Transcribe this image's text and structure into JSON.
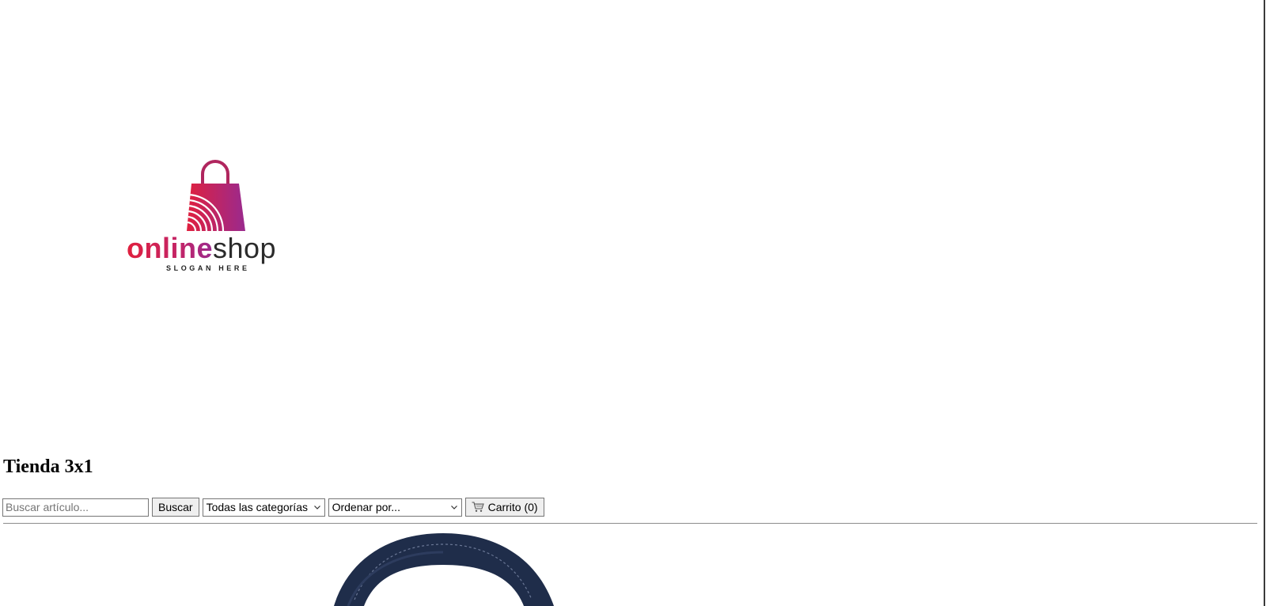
{
  "logo": {
    "word_bold": "online",
    "word_regular": "shop",
    "slogan": "SLOGAN HERE"
  },
  "store": {
    "title": "Tienda 3x1"
  },
  "toolbar": {
    "search_placeholder": "Buscar artículo...",
    "search_button": "Buscar",
    "category_select": "Todas las categorías",
    "order_select": "Ordenar por...",
    "cart_label": "Carrito (0)"
  },
  "colors": {
    "logo_gradient_start": "#e0203e",
    "logo_gradient_end": "#9a2a8e",
    "product_bag": "#1f2d4a"
  },
  "icons": {
    "cart": "cart-icon",
    "chevron": "chevron-down-icon",
    "logo": "shopping-bag-icon"
  }
}
